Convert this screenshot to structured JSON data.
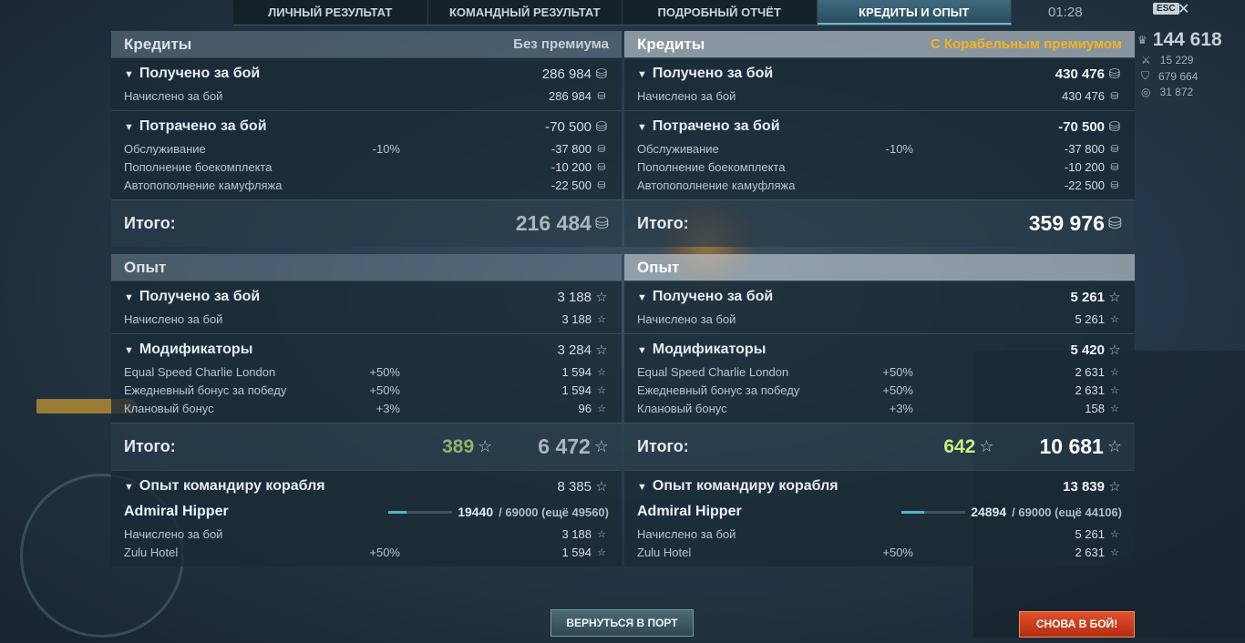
{
  "tabs": [
    "ЛИЧНЫЙ РЕЗУЛЬТАТ",
    "КОМАНДНЫЙ РЕЗУЛЬТАТ",
    "ПОДРОБНЫЙ ОТЧЁТ",
    "КРЕДИТЫ И ОПЫТ"
  ],
  "active_tab": 3,
  "timer": "01:28",
  "esc_label": "ESC",
  "right_stats": {
    "main": "144 618",
    "a": "15 229",
    "b": "679 664",
    "c": "31 872"
  },
  "left": {
    "credits_title": "Кредиты",
    "credits_sub": "Без премиума",
    "received_label": "Получено за бой",
    "received_value": "286 984",
    "accrued_label": "Начислено за бой",
    "accrued_value": "286 984",
    "spent_label": "Потрачено за бой",
    "spent_value": "-70 500",
    "maint_label": "Обслуживание",
    "maint_pct": "-10%",
    "maint_value": "-37 800",
    "ammo_label": "Пополнение боекомплекта",
    "ammo_value": "-10 200",
    "camo_label": "Автопополнение камуфляжа",
    "camo_value": "-22 500",
    "total_label": "Итого:",
    "credits_total": "216 484",
    "xp_title": "Опыт",
    "xp_received_label": "Получено за бой",
    "xp_received_value": "3 188",
    "xp_accrued_label": "Начислено за бой",
    "xp_accrued_value": "3 188",
    "mods_label": "Модификаторы",
    "mods_value": "3 284",
    "mod1_label": "Equal Speed Charlie London",
    "mod1_pct": "+50%",
    "mod1_value": "1 594",
    "mod2_label": "Ежедневный бонус за победу",
    "mod2_pct": "+50%",
    "mod2_value": "1 594",
    "mod3_label": "Клановый бонус",
    "mod3_pct": "+3%",
    "mod3_value": "96",
    "xp_total_label": "Итого:",
    "xp_free": "389",
    "xp_total": "6 472",
    "cap_label": "Опыт командиру корабля",
    "cap_value": "8 385",
    "captain_name": "Admiral Hipper",
    "cap_progress": "19440",
    "cap_progress_rest": "/ 69000 (ещё 49560)",
    "cap_fill": 0.28,
    "cap_accrued_label": "Начислено за бой",
    "cap_accrued_value": "3 188",
    "zulu_label": "Zulu Hotel",
    "zulu_pct": "+50%",
    "zulu_value": "1 594"
  },
  "right": {
    "credits_title": "Кредиты",
    "credits_sub": "С Корабельным премиумом",
    "received_label": "Получено за бой",
    "received_value": "430 476",
    "accrued_label": "Начислено за бой",
    "accrued_value": "430 476",
    "spent_label": "Потрачено за бой",
    "spent_value": "-70 500",
    "maint_label": "Обслуживание",
    "maint_pct": "-10%",
    "maint_value": "-37 800",
    "ammo_label": "Пополнение боекомплекта",
    "ammo_value": "-10 200",
    "camo_label": "Автопополнение камуфляжа",
    "camo_value": "-22 500",
    "total_label": "Итого:",
    "credits_total": "359 976",
    "xp_title": "Опыт",
    "xp_received_label": "Получено за бой",
    "xp_received_value": "5 261",
    "xp_accrued_label": "Начислено за бой",
    "xp_accrued_value": "5 261",
    "mods_label": "Модификаторы",
    "mods_value": "5 420",
    "mod1_label": "Equal Speed Charlie London",
    "mod1_pct": "+50%",
    "mod1_value": "2 631",
    "mod2_label": "Ежедневный бонус за победу",
    "mod2_pct": "+50%",
    "mod2_value": "2 631",
    "mod3_label": "Клановый бонус",
    "mod3_pct": "+3%",
    "mod3_value": "158",
    "xp_total_label": "Итого:",
    "xp_free": "642",
    "xp_total": "10 681",
    "cap_label": "Опыт командиру корабля",
    "cap_value": "13 839",
    "captain_name": "Admiral Hipper",
    "cap_progress": "24894",
    "cap_progress_rest": "/ 69000 (ещё 44106)",
    "cap_fill": 0.36,
    "cap_accrued_label": "Начислено за бой",
    "cap_accrued_value": "5 261",
    "zulu_label": "Zulu Hotel",
    "zulu_pct": "+50%",
    "zulu_value": "2 631"
  },
  "buttons": {
    "port": "ВЕРНУТЬСЯ В ПОРТ",
    "battle": "СНОВА В БОЙ!"
  },
  "icons": {
    "credits": "silver-coin-icon",
    "xp": "star-icon"
  }
}
